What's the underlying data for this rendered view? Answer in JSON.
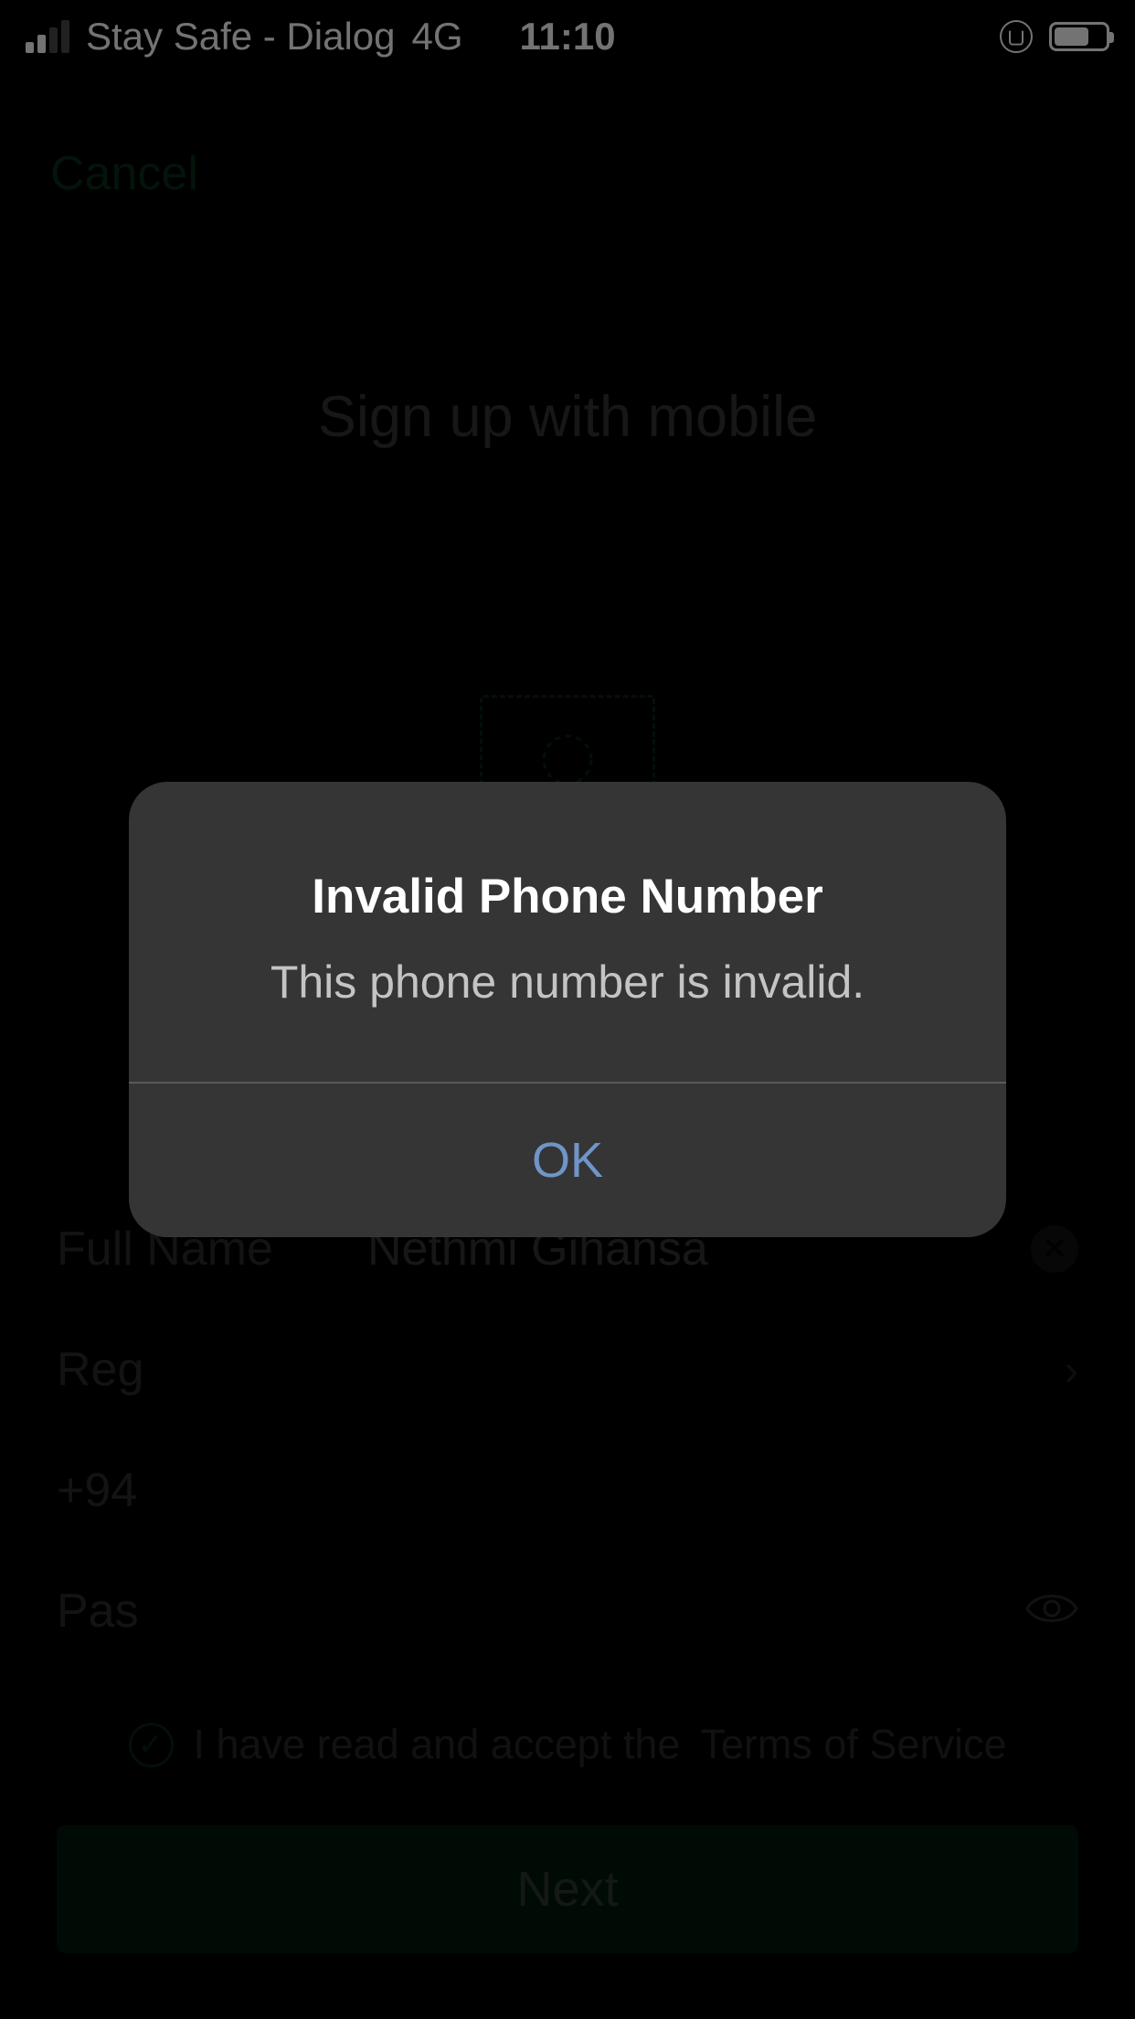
{
  "status": {
    "carrier": "Stay Safe - Dialog",
    "network": "4G",
    "time": "11:10"
  },
  "nav": {
    "cancel": "Cancel"
  },
  "page": {
    "title": "Sign up with mobile"
  },
  "form": {
    "full_name_label": "Full Name",
    "full_name_value": "Nethmi Gihansa",
    "region_label": "Reg",
    "phone_prefix": "+94",
    "password_label": "Pas"
  },
  "terms": {
    "text_pre": "I have read and accept the",
    "link": "Terms of Service"
  },
  "buttons": {
    "next": "Next"
  },
  "alert": {
    "title": "Invalid Phone Number",
    "message": "This phone number is invalid.",
    "ok": "OK"
  }
}
